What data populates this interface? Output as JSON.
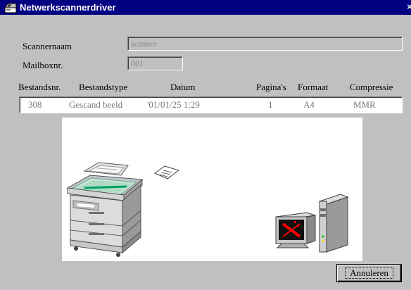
{
  "window": {
    "title": "Netwerkscannerdriver",
    "close_glyph": "×"
  },
  "form": {
    "scanner_name_label": "Scannernaam",
    "scanner_name_value": "scanner",
    "mailbox_label": "Mailboxnr.",
    "mailbox_value": "001"
  },
  "table": {
    "columns": [
      "Bestandsnr.",
      "Bestandstype",
      "Datum",
      "Pagina's",
      "Formaat",
      "Compressie"
    ],
    "rows": [
      [
        "308",
        "Gescand beeld",
        "'01/01/25  1:29",
        "1",
        "A4",
        "MMR"
      ]
    ]
  },
  "illustration": {
    "icons": [
      "copier-scanner-icon",
      "document-transfer-icon",
      "computer-icon"
    ],
    "accent_colors": {
      "logo_red": "#ff0000",
      "scanner_green": "#00a060"
    }
  },
  "buttons": {
    "cancel_label": "Annuleren"
  }
}
